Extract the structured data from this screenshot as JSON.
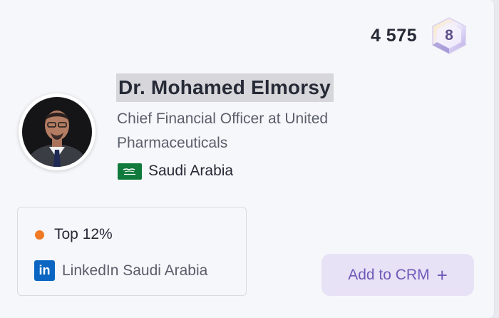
{
  "profile": {
    "score": "4 575",
    "level": "8",
    "name": "Dr. Mohamed Elmorsy",
    "job_title": "Chief Financial Officer at United Pharmaceuticals",
    "country": "Saudi Arabia",
    "flag_icon": "saudi-arabia-flag-icon"
  },
  "stats": {
    "rank_label": "Top 12%",
    "rank_dot_color": "#f07a23",
    "linkedin_icon_text": "in",
    "linkedin_label": "LinkedIn Saudi Arabia"
  },
  "actions": {
    "add_to_crm_label": "Add to CRM",
    "add_icon": "+"
  },
  "colors": {
    "accent": "#6d5ab9",
    "button_bg": "#e8e2f6",
    "linkedin": "#0a66c2"
  }
}
